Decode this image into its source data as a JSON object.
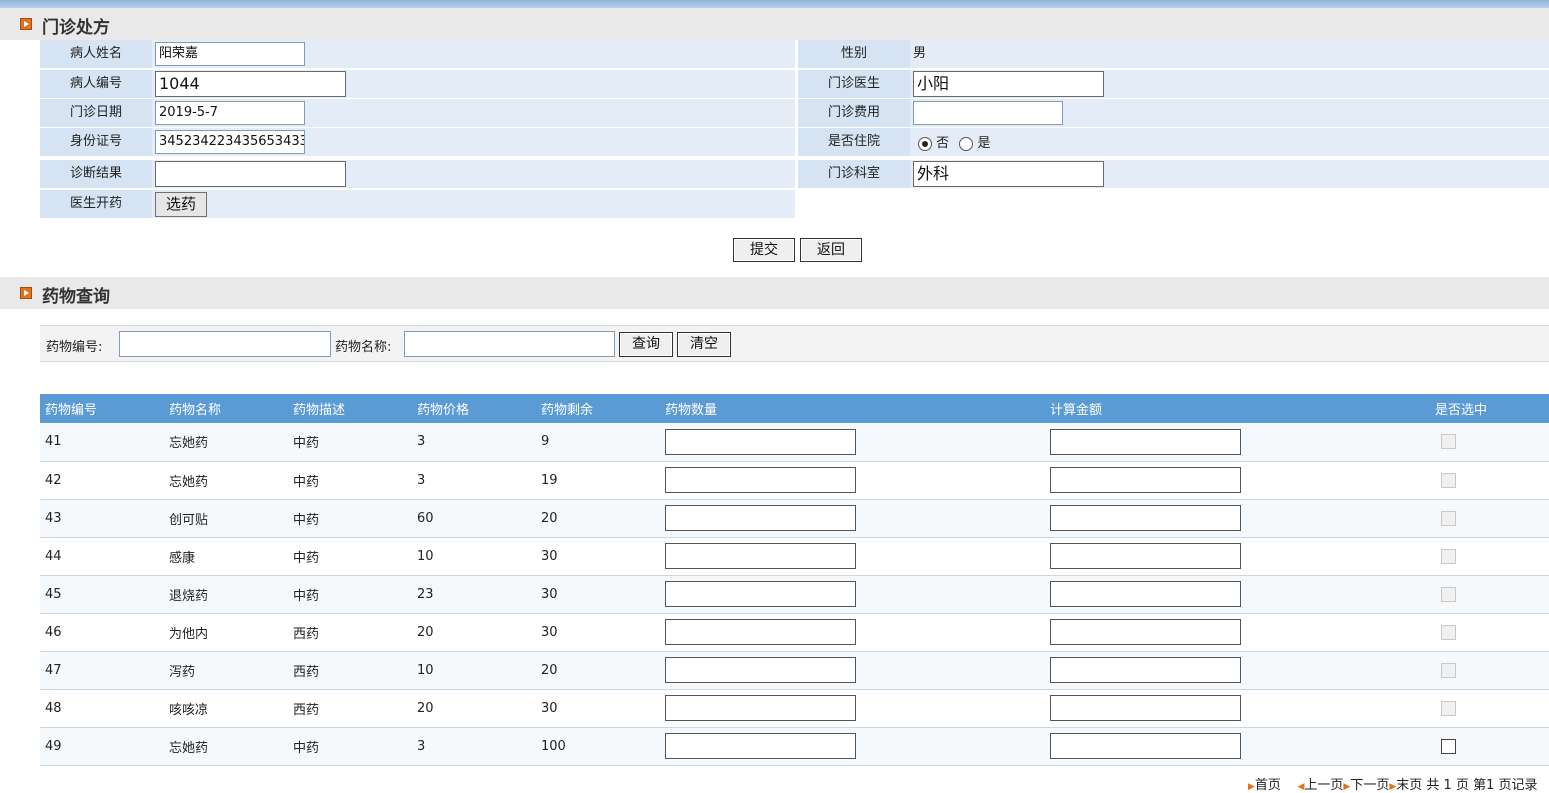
{
  "prescription": {
    "section_title": "门诊处方",
    "fields": {
      "patient_name": {
        "label": "病人姓名",
        "value": "阳荣嘉"
      },
      "gender": {
        "label": "性别",
        "value": "男"
      },
      "patient_id": {
        "label": "病人编号",
        "value": "1044"
      },
      "doctor": {
        "label": "门诊医生",
        "value": "小阳"
      },
      "visit_date": {
        "label": "门诊日期",
        "value": "2019-5-7"
      },
      "fee": {
        "label": "门诊费用",
        "value": ""
      },
      "id_card": {
        "label": "身份证号",
        "value": "345234223435653433"
      },
      "hospitalized": {
        "label": "是否住院",
        "option_no": "否",
        "option_yes": "是",
        "selected": "否"
      },
      "diagnosis": {
        "label": "诊断结果",
        "value": ""
      },
      "department": {
        "label": "门诊科室",
        "value": "外科"
      },
      "prescribe": {
        "label": "医生开药",
        "button": "选药"
      }
    },
    "submit_label": "提交",
    "back_label": "返回"
  },
  "drug_query": {
    "section_title": "药物查询",
    "search": {
      "id_label": "药物编号:",
      "name_label": "药物名称:",
      "query_label": "查询",
      "clear_label": "清空"
    },
    "columns": [
      "药物编号",
      "药物名称",
      "药物描述",
      "药物价格",
      "药物剩余",
      "药物数量",
      "计算金额",
      "是否选中"
    ],
    "rows": [
      {
        "id": "41",
        "name": "忘她药",
        "desc": "中药",
        "price": "3",
        "stock": "9",
        "enabled": false
      },
      {
        "id": "42",
        "name": "忘她药",
        "desc": "中药",
        "price": "3",
        "stock": "19",
        "enabled": false
      },
      {
        "id": "43",
        "name": "创可贴",
        "desc": "中药",
        "price": "60",
        "stock": "20",
        "enabled": false
      },
      {
        "id": "44",
        "name": "感康",
        "desc": "中药",
        "price": "10",
        "stock": "30",
        "enabled": false
      },
      {
        "id": "45",
        "name": "退烧药",
        "desc": "中药",
        "price": "23",
        "stock": "30",
        "enabled": false
      },
      {
        "id": "46",
        "name": "为他内",
        "desc": "西药",
        "price": "20",
        "stock": "30",
        "enabled": false
      },
      {
        "id": "47",
        "name": "泻药",
        "desc": "西药",
        "price": "10",
        "stock": "20",
        "enabled": false
      },
      {
        "id": "48",
        "name": "咳咳凉",
        "desc": "西药",
        "price": "20",
        "stock": "30",
        "enabled": false
      },
      {
        "id": "49",
        "name": "忘她药",
        "desc": "中药",
        "price": "3",
        "stock": "100",
        "enabled": true
      }
    ],
    "pager": {
      "first": "首页",
      "prev": "上一页",
      "next": "下一页",
      "last": "末页",
      "summary": "共 1 页 第1 页记录"
    }
  },
  "colors": {
    "accent": "#e0731d",
    "header_blue": "#5b9bd5",
    "row_label_bg": "#d5e3f2",
    "row_bg": "#e4edf7"
  }
}
